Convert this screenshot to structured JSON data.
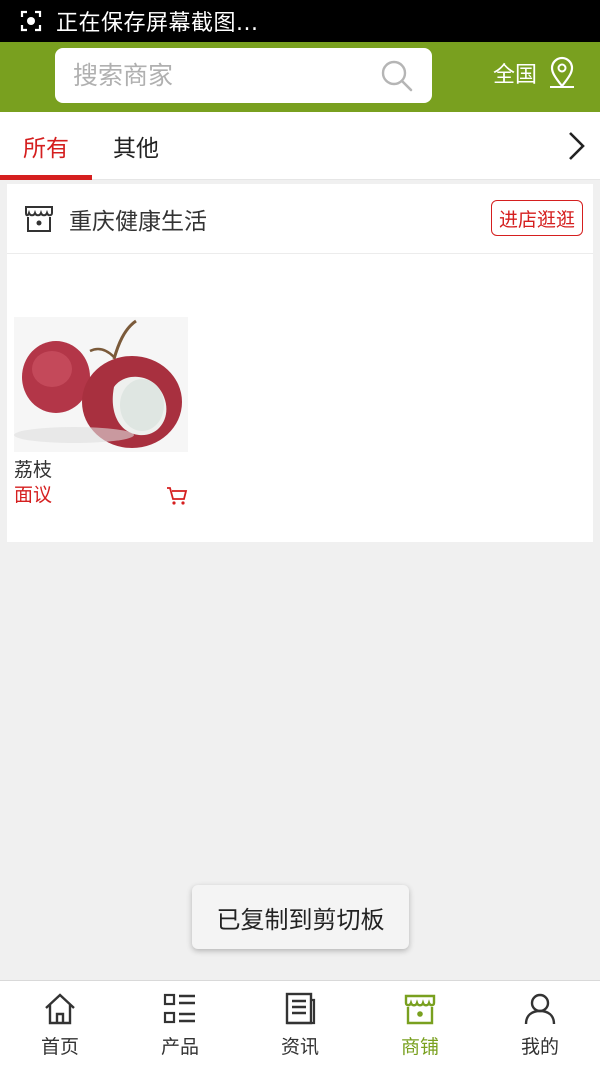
{
  "status_bar": {
    "text": "正在保存屏幕截图..."
  },
  "header": {
    "search_placeholder": "搜索商家",
    "region_label": "全国",
    "accent_color": "#79a01f"
  },
  "tabs": {
    "items": [
      {
        "label": "所有",
        "active": true
      },
      {
        "label": "其他",
        "active": false
      }
    ],
    "more_icon": "chevron-right-icon"
  },
  "shop": {
    "name": "重庆健康生活",
    "enter_label": "进店逛逛",
    "icon": "store-icon",
    "products": [
      {
        "name": "荔枝",
        "price": "面议",
        "icon": "cart-icon"
      }
    ]
  },
  "toast": {
    "text": "已复制到剪切板"
  },
  "bottom_nav": {
    "items": [
      {
        "label": "首页",
        "icon": "home-icon",
        "active": false
      },
      {
        "label": "产品",
        "icon": "list-icon",
        "active": false
      },
      {
        "label": "资讯",
        "icon": "news-icon",
        "active": false
      },
      {
        "label": "商铺",
        "icon": "store-icon",
        "active": true
      },
      {
        "label": "我的",
        "icon": "user-icon",
        "active": false
      }
    ]
  },
  "colors": {
    "accent": "#79a01f",
    "highlight": "#d51f1f"
  }
}
